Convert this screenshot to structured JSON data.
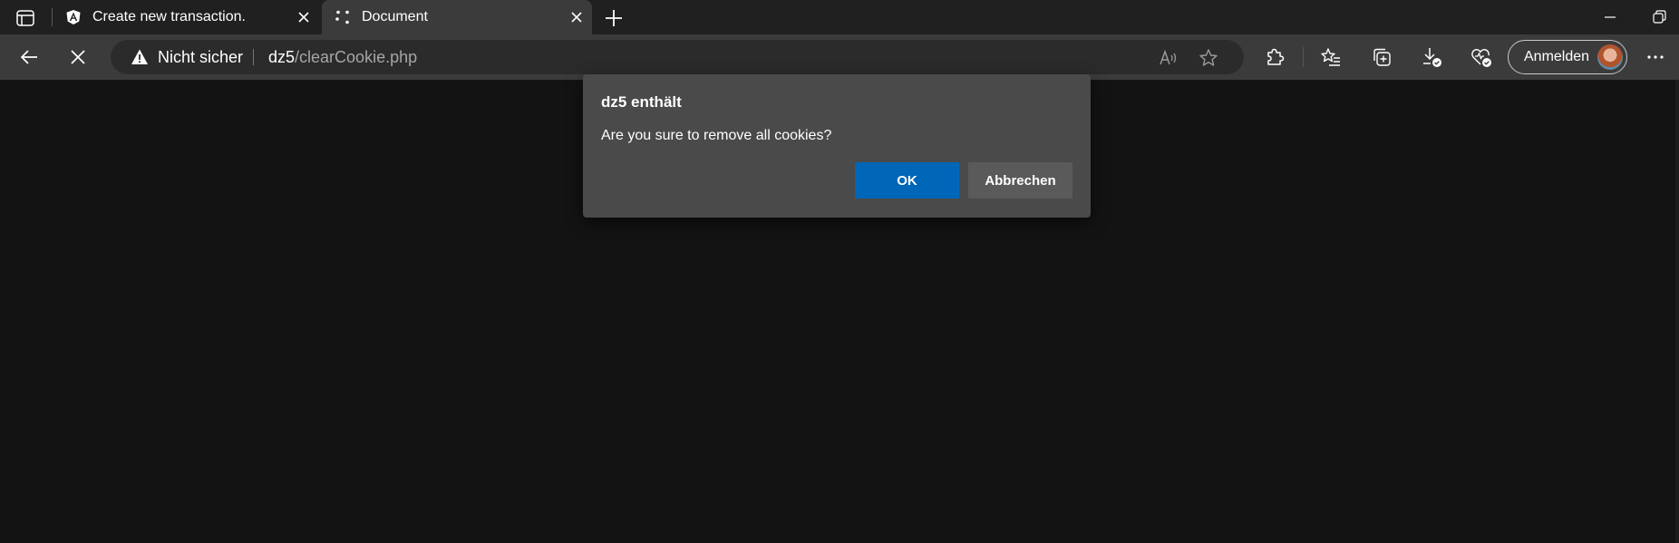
{
  "tabs": [
    {
      "title": "Create new transaction.",
      "icon": "angular-logo-icon",
      "active": false
    },
    {
      "title": "Document",
      "icon": "loading-icon",
      "active": true
    }
  ],
  "addressbar": {
    "security_label": "Nicht sicher",
    "url_host": "dz5",
    "url_path": "/clearCookie.php"
  },
  "toolbar": {
    "signin_label": "Anmelden"
  },
  "dialog": {
    "title": "dz5 enthält",
    "message": "Are you sure to remove all cookies?",
    "ok_label": "OK",
    "cancel_label": "Abbrechen"
  },
  "colors": {
    "accent": "#0066b8",
    "page_background": "#131313",
    "toolbar": "#3b3b3b",
    "tabstrip": "#202020",
    "dialog_background": "#4a4a4a"
  }
}
